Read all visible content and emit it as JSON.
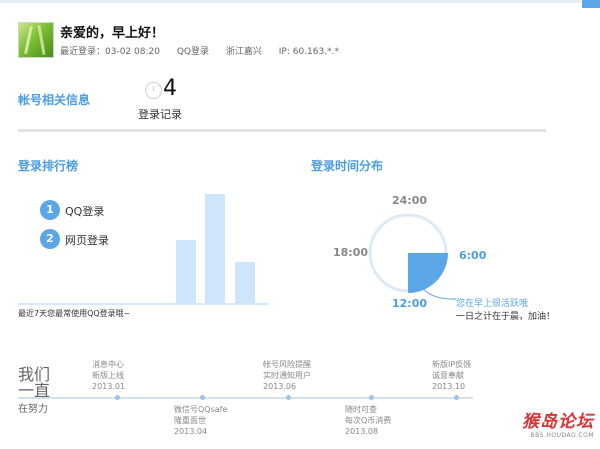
{
  "profile": {
    "greeting": "亲爱的，早上好！",
    "last_login_label": "最近登录：03-02  08:20",
    "last_login_method": "QQ登录",
    "last_login_region": "浙江嘉兴",
    "last_login_ip": "IP:  60.163.*.*"
  },
  "account": {
    "title": "帐号相关信息",
    "login_count": "4",
    "login_count_label": "登录记录"
  },
  "ranking": {
    "title": "登录排行榜",
    "items": [
      {
        "rank": "1",
        "label": "QQ登录"
      },
      {
        "rank": "2",
        "label": "网页登录"
      }
    ],
    "note": "最近7天您最常使用QQ登录哦~",
    "chart_values": [
      0.58,
      1.0,
      0.38
    ]
  },
  "time_dist": {
    "title": "登录时间分布",
    "labels": {
      "top": "24:00",
      "left": "18:00",
      "right": "6:00",
      "bottom": "12:00"
    },
    "tip_highlight": "您在早上很活跃哦",
    "tip_sub": "一日之计在于晨，加油！"
  },
  "timeline": {
    "heading": [
      "我们",
      "一直",
      "在努力"
    ],
    "events": [
      {
        "line1": "消息中心",
        "line2": "新版上线",
        "date": "2013.01"
      },
      {
        "line1": "微信号QQsafe",
        "line2": "隆重面世",
        "date": "2013.04"
      },
      {
        "line1": "帐号风险提醒",
        "line2": "实时通知用户",
        "date": "2013.06"
      },
      {
        "line1": "随时可查",
        "line2": "每次Q币消费",
        "date": "2013.08"
      },
      {
        "line1": "新版IP反馈",
        "line2": "诚意奉献",
        "date": "2013.10"
      }
    ]
  },
  "watermark": {
    "brand": "猴岛论坛",
    "url": "BBS.HOUDAO.COM"
  },
  "colors": {
    "accent": "#5aa6e6",
    "bar": "#cfe5fb"
  }
}
